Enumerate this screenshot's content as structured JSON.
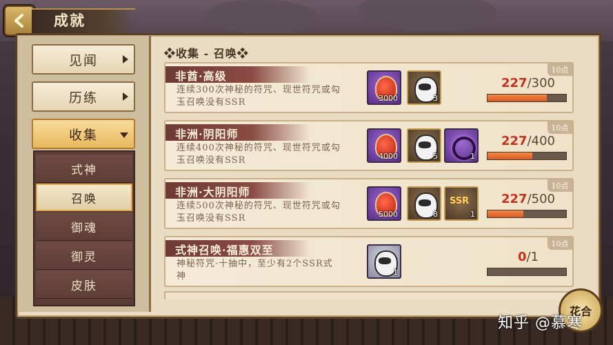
{
  "header": {
    "title": "成就"
  },
  "sidebar": {
    "items": [
      {
        "label": "见闻"
      },
      {
        "label": "历练"
      },
      {
        "label": "收集"
      }
    ],
    "sub_items": [
      {
        "label": "式神"
      },
      {
        "label": "召唤"
      },
      {
        "label": "御魂"
      },
      {
        "label": "御灵"
      },
      {
        "label": "皮肤"
      }
    ]
  },
  "section_title": "❖收集 - 召唤❖",
  "achievements": [
    {
      "title": "非酋·高级",
      "desc": "连续300次神秘的符咒、现世符咒或勾玉召唤没有SSR",
      "points": "10点",
      "rewards": [
        {
          "icon": "mystery-charm-icon",
          "count": "3000"
        },
        {
          "icon": "daruma-icon",
          "count": "3"
        }
      ],
      "current": "227",
      "total": "/300",
      "progress": 0.757
    },
    {
      "title": "非洲·阴阳师",
      "desc": "连续400次神秘的符咒、现世符咒或勾玉召唤没有SSR",
      "points": "10点",
      "rewards": [
        {
          "icon": "mystery-charm-icon",
          "count": "4000"
        },
        {
          "icon": "daruma-icon",
          "count": "5"
        },
        {
          "icon": "avatar-frame-ring-icon",
          "count": "1"
        }
      ],
      "current": "227",
      "total": "/400",
      "progress": 0.568
    },
    {
      "title": "非洲·大阴阳师",
      "desc": "连续500次神秘的符咒、现世符咒或勾玉召唤没有SSR",
      "points": "10点",
      "rewards": [
        {
          "icon": "mystery-charm-icon",
          "count": "5000"
        },
        {
          "icon": "daruma-icon",
          "count": "8"
        },
        {
          "icon": "ssr-summon-icon",
          "count": "1"
        }
      ],
      "current": "227",
      "total": "/500",
      "progress": 0.454
    },
    {
      "title": "式神召唤·福惠双至",
      "desc": "神秘符咒·十抽中，至少有2个SSR式神",
      "points": "10点",
      "rewards": [
        {
          "icon": "material-daruma-icon",
          "count": "1"
        }
      ],
      "current": "0",
      "total": "/1",
      "progress": 0
    }
  ],
  "watermark": "知乎 @慕寒",
  "corner_logo": "花合"
}
